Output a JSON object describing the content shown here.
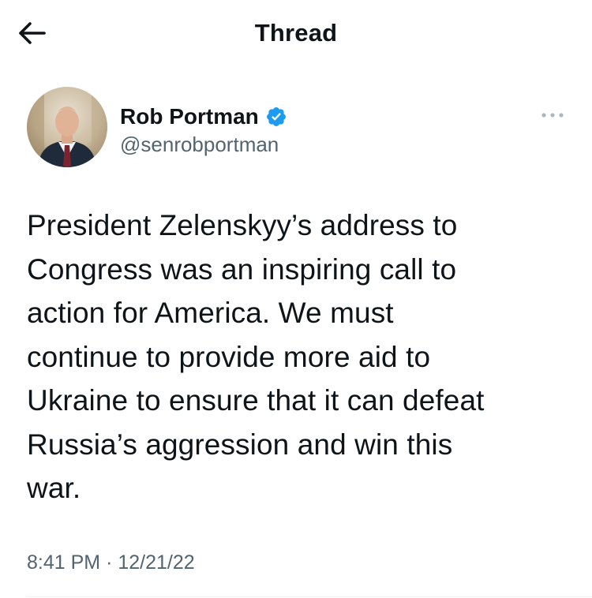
{
  "header": {
    "title": "Thread",
    "back_icon": "arrow-left-icon"
  },
  "author": {
    "name": "Rob Portman",
    "handle": "@senrobportman",
    "verified": true,
    "verified_icon": "verified-badge-icon",
    "verified_color": "#1d9bf0",
    "more_icon": "more-horizontal-icon"
  },
  "tweet": {
    "lines": [
      "President Zelenskyy’s address to",
      "Congress was an inspiring call to",
      "action for America. We must",
      "continue to provide more aid to",
      "Ukraine to ensure that it can defeat",
      "Russia’s aggression and win this",
      "war."
    ]
  },
  "meta": {
    "time": "8:41 PM",
    "separator": "·",
    "date": "12/21/22"
  },
  "colors": {
    "text_primary": "#0f1419",
    "text_secondary": "#536471",
    "accent": "#1d9bf0",
    "divider": "#eff3f4"
  }
}
